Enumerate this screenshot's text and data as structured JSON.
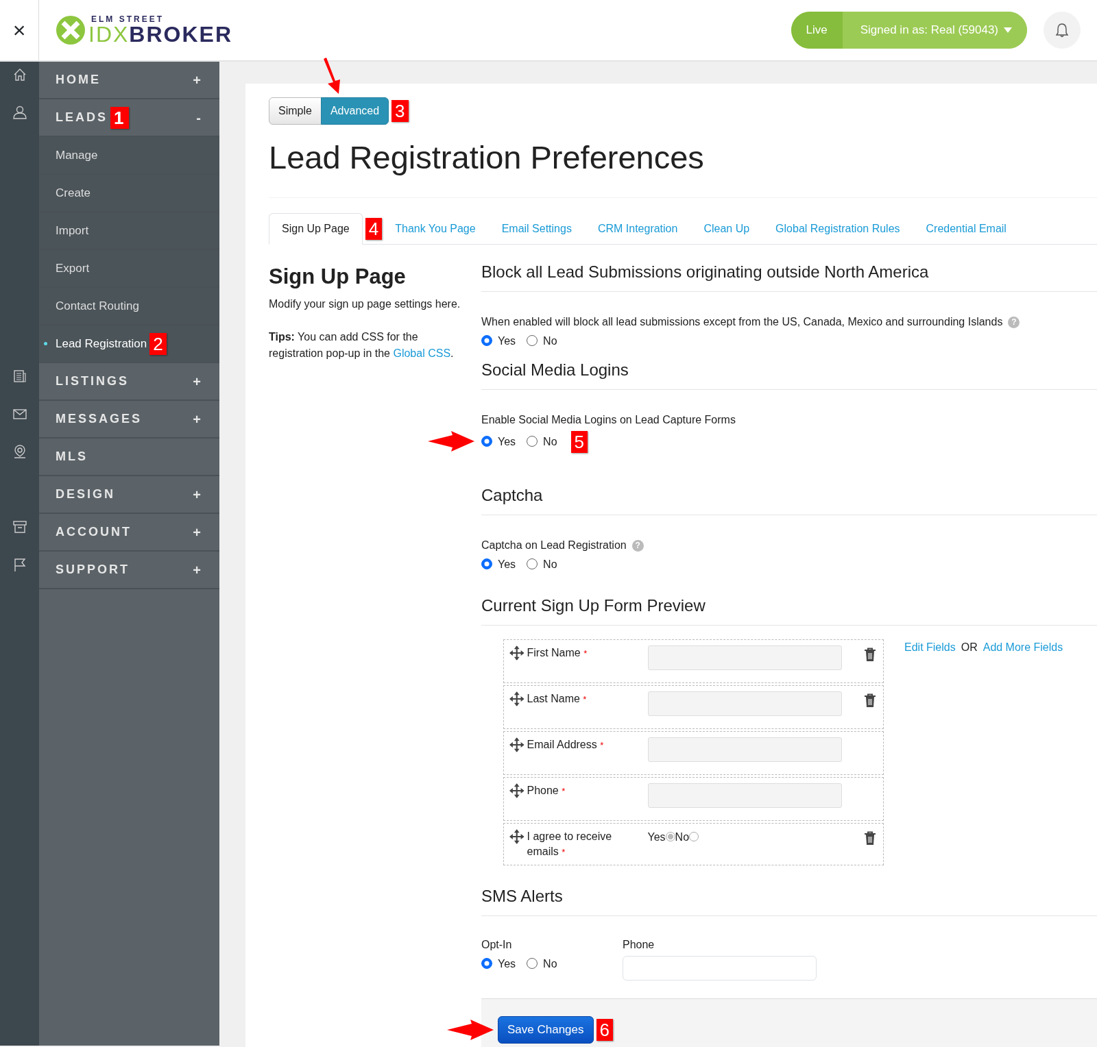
{
  "header": {
    "close": "×",
    "logo": {
      "top": "ELM STREET",
      "brand_a": "IDX",
      "brand_b": "BROKER"
    },
    "live": "Live",
    "signed_in": "Signed in as: Real (59043)"
  },
  "sidebar": {
    "items": [
      {
        "kind": "section",
        "label": "HOME",
        "toggle": "+",
        "selected": false
      },
      {
        "kind": "section",
        "label": "LEADS",
        "toggle": "-",
        "selected": false,
        "callout": "1"
      },
      {
        "kind": "subitem",
        "label": "Manage",
        "selected": false
      },
      {
        "kind": "subitem",
        "label": "Create",
        "selected": false
      },
      {
        "kind": "subitem",
        "label": "Import",
        "selected": false
      },
      {
        "kind": "subitem",
        "label": "Export",
        "selected": false
      },
      {
        "kind": "subitem",
        "label": "Contact Routing",
        "selected": false
      },
      {
        "kind": "subitem",
        "label": "Lead Registration",
        "selected": true,
        "callout": "2"
      },
      {
        "kind": "section",
        "label": "LISTINGS",
        "toggle": "+",
        "selected": false
      },
      {
        "kind": "section",
        "label": "MESSAGES",
        "toggle": "+",
        "selected": false
      },
      {
        "kind": "section",
        "label": "MLS",
        "selected": false
      },
      {
        "kind": "section",
        "label": "DESIGN",
        "toggle": "+",
        "selected": false
      },
      {
        "kind": "section",
        "label": "ACCOUNT",
        "toggle": "+",
        "selected": false
      },
      {
        "kind": "section",
        "label": "SUPPORT",
        "toggle": "+",
        "selected": false
      }
    ]
  },
  "mode_toggle": {
    "options": [
      {
        "label": "Simple",
        "selected": false
      },
      {
        "label": "Advanced",
        "selected": true
      }
    ],
    "callout": "3",
    "arrow": true
  },
  "title": "Lead Registration Preferences",
  "tabs": [
    {
      "label": "Sign Up Page",
      "selected": true,
      "callout": "4"
    },
    {
      "label": "Thank You Page",
      "selected": false
    },
    {
      "label": "Email Settings",
      "selected": false
    },
    {
      "label": "CRM Integration",
      "selected": false
    },
    {
      "label": "Clean Up",
      "selected": false
    },
    {
      "label": "Global Registration Rules",
      "selected": false
    },
    {
      "label": "Credential Email",
      "selected": false
    }
  ],
  "intro": {
    "heading": "Sign Up Page",
    "text": "Modify your sign up page settings here.",
    "tips": "**Tips:** You can add CSS for the registration pop-up in the",
    "tips_link": "Global CSS",
    "tips_end": "."
  },
  "settings": [
    {
      "heading": "Block all Lead Submissions originating outside North America",
      "text": "When enabled will block all lead submissions except from the US, Canada, Mexico and surrounding Islands",
      "help": "?",
      "options": [
        {
          "label": "Yes",
          "selected": true
        },
        {
          "label": "No",
          "selected": false
        }
      ]
    },
    {
      "heading": "Social Media Logins",
      "text": "Enable Social Media Logins on Lead Capture Forms",
      "options": [
        {
          "label": "Yes",
          "selected": true
        },
        {
          "label": "No",
          "selected": false
        }
      ],
      "callout": "5",
      "arrow": true
    },
    {
      "heading": "Captcha",
      "text": "Captcha on Lead Registration",
      "help": "?",
      "options": [
        {
          "label": "Yes",
          "selected": true
        },
        {
          "label": "No",
          "selected": false
        }
      ]
    }
  ],
  "preview": {
    "heading": "Current Sign Up Form Preview",
    "fields": [
      {
        "kind": "text",
        "label": "First Name",
        "required_mark": "*",
        "deletable": true
      },
      {
        "kind": "text",
        "label": "Last Name",
        "required_mark": "*",
        "deletable": true
      },
      {
        "kind": "text",
        "label": "Email Address",
        "required_mark": "*",
        "deletable": false
      },
      {
        "kind": "text",
        "label": "Phone",
        "required_mark": "*",
        "deletable": false
      },
      {
        "kind": "radio",
        "label": "I agree to receive emails",
        "required_mark": "*",
        "deletable": true,
        "options": [
          {
            "label": "Yes",
            "selected": true
          },
          {
            "label": "No",
            "selected": false
          }
        ]
      }
    ],
    "edit_link": "Edit Fields",
    "or": "OR",
    "add_link": "Add More Fields"
  },
  "sms": {
    "heading": "SMS Alerts",
    "optin_label": "Opt-In",
    "options": [
      {
        "label": "Yes",
        "selected": true
      },
      {
        "label": "No",
        "selected": false
      }
    ],
    "phone_label": "Phone"
  },
  "save": {
    "label": "Save Changes",
    "callout": "6",
    "arrow": true
  }
}
